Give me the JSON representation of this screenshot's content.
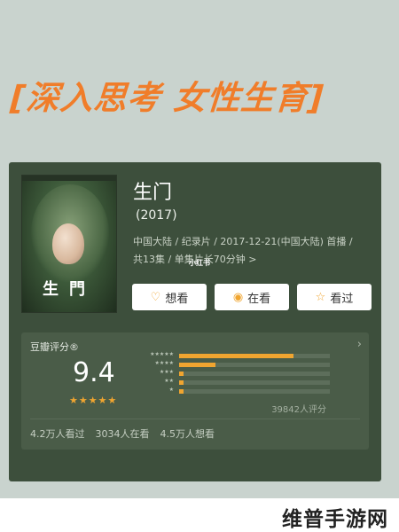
{
  "headline": "[深入思考 女性生育]",
  "movie": {
    "title": "生门",
    "year": "(2017)",
    "meta_line1": "中国大陆 / 纪录片 / 2017-12-21(中国大陆) 首播 /",
    "meta_line2": "共13集 / 单集片长70分钟 >",
    "meta_watermark": "小红书",
    "poster_title": "生門"
  },
  "actions": {
    "want_label": "想看",
    "watching_label": "在看",
    "watched_label": "看过",
    "want_icon": "heart-plus-icon",
    "watching_icon": "circle-dot-icon",
    "watched_icon": "star-outline-icon"
  },
  "rating": {
    "label": "豆瓣评分®",
    "score": "9.4",
    "stars_display": "★★★★★",
    "distribution_percent": [
      76,
      24,
      1,
      1,
      0.5
    ],
    "star_labels": [
      "★★★★★",
      "★★★★",
      "★★★",
      "★★",
      "★"
    ],
    "votes": "39842人评分"
  },
  "stats": {
    "watched": "4.2万人看过",
    "watching": "3034人在看",
    "want": "4.5万人想看"
  },
  "site_watermark": "维普手游网",
  "colors": {
    "accent": "#f0a530",
    "headline": "#f07d2a",
    "card": "#3d4f3c"
  }
}
